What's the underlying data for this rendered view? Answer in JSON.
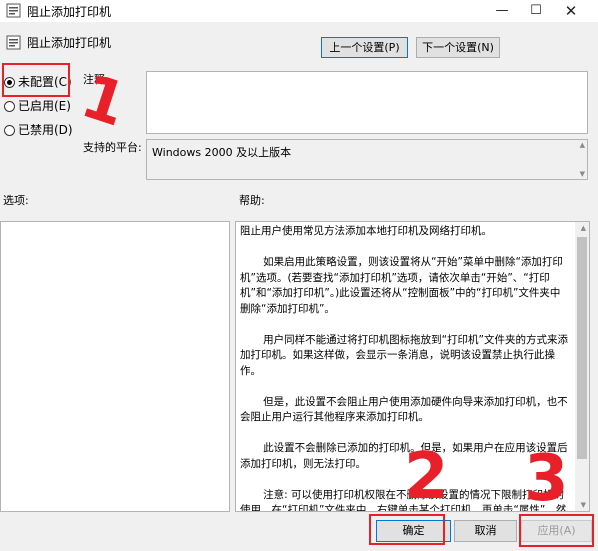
{
  "window": {
    "title": "阻止添加打印机",
    "minimize_glyph": "—",
    "maximize_glyph": "☐",
    "close_glyph": "✕"
  },
  "header": {
    "policy_title": "阻止添加打印机",
    "prev_button": "上一个设置(P)",
    "next_button": "下一个设置(N)"
  },
  "state_options": [
    {
      "label": "未配置(C)",
      "selected": true
    },
    {
      "label": "已启用(E)",
      "selected": false
    },
    {
      "label": "已禁用(D)",
      "selected": false
    }
  ],
  "comment": {
    "label": "注释:",
    "value": ""
  },
  "platform": {
    "label": "支持的平台:",
    "value": "Windows 2000 及以上版本"
  },
  "options": {
    "label": "选项:"
  },
  "help": {
    "label": "帮助:",
    "paragraphs": [
      "阻止用户使用常见方法添加本地打印机及网络打印机。",
      "如果启用此策略设置，则该设置将从“开始”菜单中删除“添加打印机”选项。(若要查找“添加打印机”选项，请依次单击“开始”、“打印机”和“添加打印机”。)此设置还将从“控制面板”中的“打印机”文件夹中删除“添加打印机”。",
      "用户同样不能通过将打印机图标拖放到“打印机”文件夹的方式来添加打印机。如果这样做，会显示一条消息，说明该设置禁止执行此操作。",
      "但是，此设置不会阻止用户使用添加硬件向导来添加打印机，也不会阻止用户运行其他程序来添加打印机。",
      "此设置不会删除已添加的打印机。但是，如果用户在应用该设置后添加打印机，则无法打印。",
      "注意: 可以使用打印机权限在不删除该设置的情况下限制打印机的使用。在“打印机”文件夹中，右键单击某个打印机，再单击“属性”，然后单击“安全”选项卡。"
    ]
  },
  "footer": {
    "ok_button": "确定",
    "cancel_button": "取消",
    "apply_button": "应用(A)"
  },
  "annotations": [
    "1",
    "2",
    "3"
  ],
  "colors": {
    "annotation_red": "#e8202a",
    "focus_blue": "#0078d7"
  }
}
